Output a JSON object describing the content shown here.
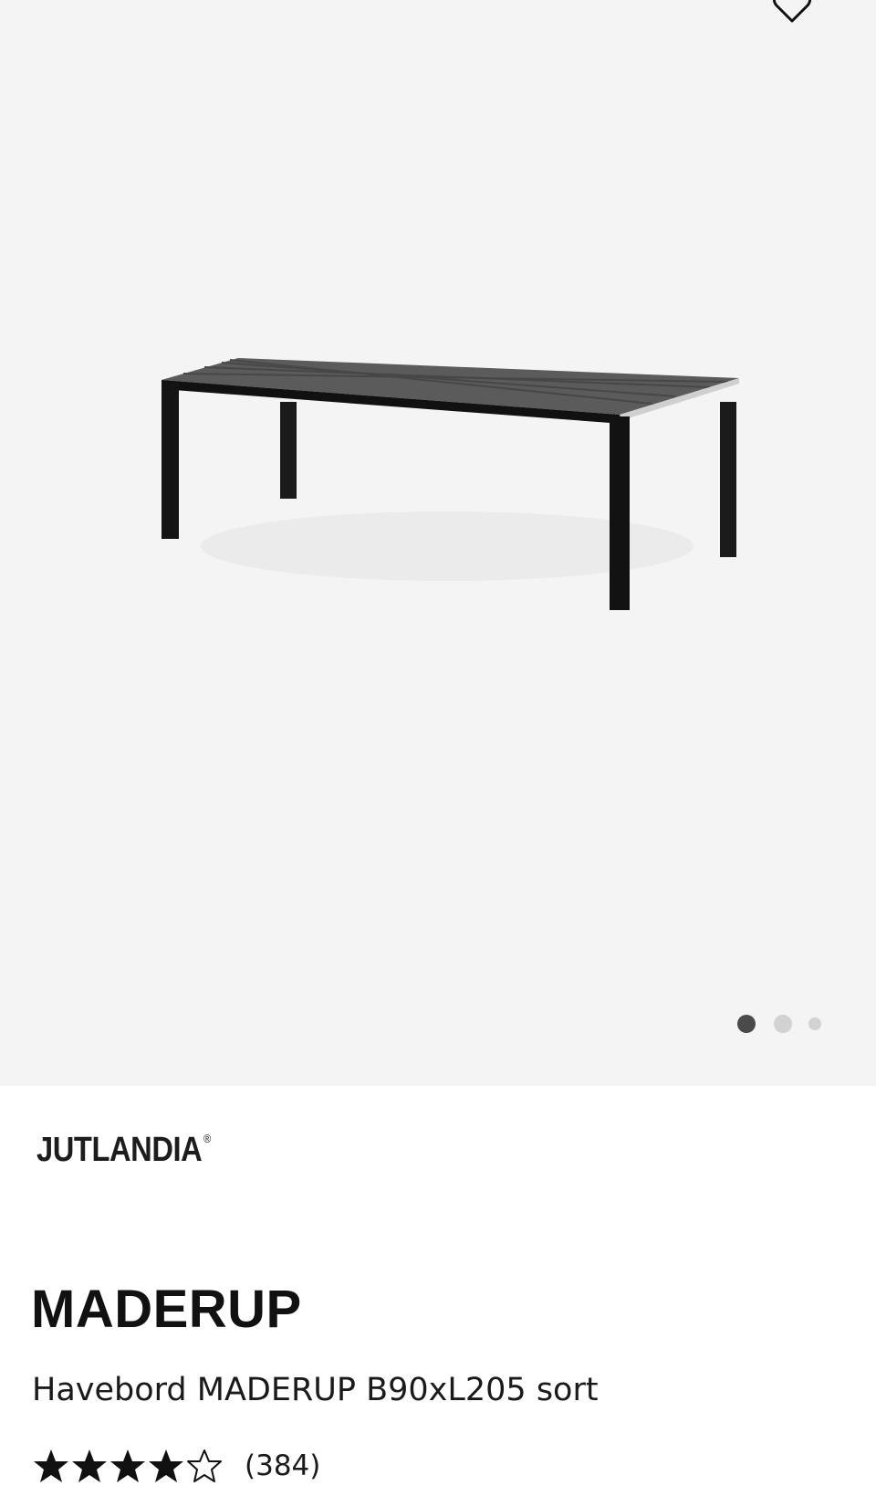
{
  "product": {
    "brand": "JUTLANDIA",
    "brand_mark": "®",
    "name": "MADERUP",
    "description": "Havebord MADERUP B90xL205 sort",
    "rating": {
      "stars_filled": 4,
      "stars_total": 5,
      "review_count": "(384)"
    }
  },
  "gallery": {
    "image": "garden-table-photo",
    "slide_count": 3,
    "active_slide": 1
  },
  "icons": {
    "favorite": "heart-outline-icon",
    "star_full": "star-filled-icon",
    "star_empty": "star-outline-icon"
  },
  "colors": {
    "gallery_bg": "#f4f4f4",
    "dot_active": "#4a4a4a",
    "dot_inactive": "#d2d2d2",
    "text": "#111111"
  }
}
